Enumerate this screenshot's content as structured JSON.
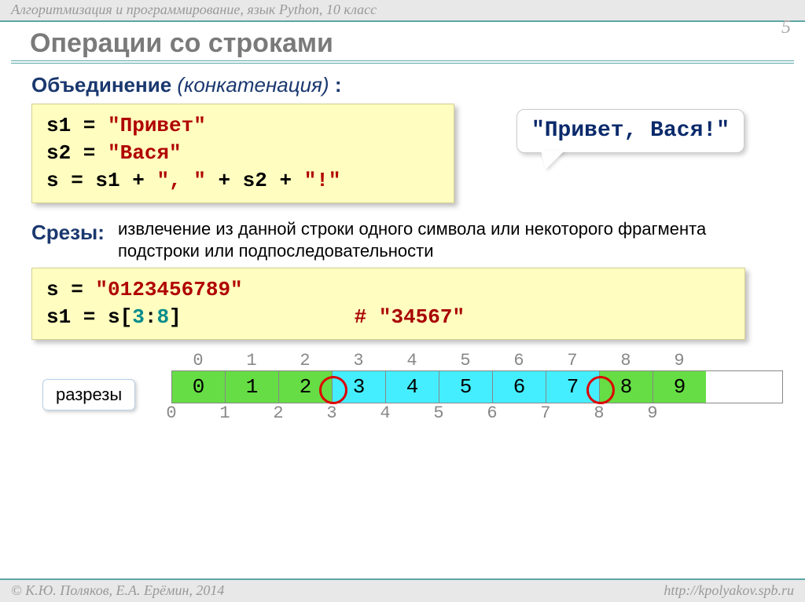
{
  "header": "Алгоритмизация и программирование, язык Python, 10 класс",
  "page_number": "5",
  "title": "Операции со строками",
  "section1": {
    "label": "Объединение",
    "italic": "(конкатенация)",
    "colon": " :",
    "code": {
      "l1a": "s1 = ",
      "l1b": "\"Привет\"",
      "l2a": "s2 = ",
      "l2b": "\"Вася\"",
      "l3a": "s  = s1 + ",
      "l3b": "\", \"",
      "l3c": " + s2 + ",
      "l3d": "\"!\""
    },
    "callout": "\"Привет, Вася!\""
  },
  "section2": {
    "label": "Срезы:",
    "desc": "извлечение из данной строки одного символа или некоторого фрагмента подстроки или подпоследовательности",
    "code": {
      "l1a": "s = ",
      "l1b": "\"0123456789\"",
      "l2a": "s1 = s[",
      "l2b": "3",
      "l2c": ":",
      "l2d": "8",
      "l2e": "]",
      "comment": "# \"34567\""
    },
    "top_idx": [
      "0",
      "1",
      "2",
      "3",
      "4",
      "5",
      "6",
      "7",
      "8",
      "9"
    ],
    "cells": [
      "0",
      "1",
      "2",
      "3",
      "4",
      "5",
      "6",
      "7",
      "8",
      "9"
    ],
    "bot_idx": [
      "0",
      "1",
      "2",
      "3",
      "4",
      "5",
      "6",
      "7",
      "8",
      "9"
    ],
    "cut_label": "разрезы"
  },
  "footer": {
    "left": "© К.Ю. Поляков, Е.А. Ерёмин, 2014",
    "right": "http://kpolyakov.spb.ru"
  }
}
